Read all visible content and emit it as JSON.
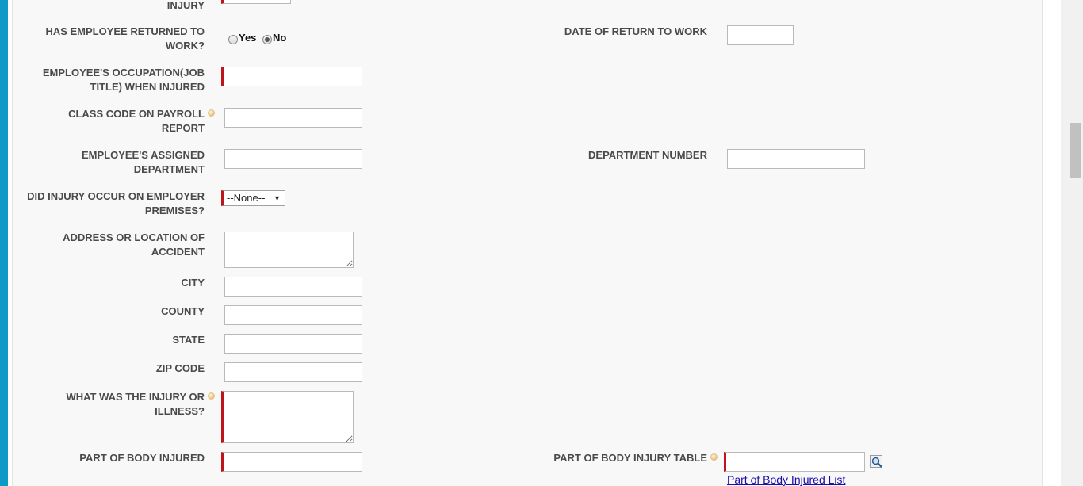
{
  "left_labels": {
    "injury_partial": "INJURY",
    "returned_to_work": "HAS EMPLOYEE RETURNED TO WORK?",
    "occupation": "EMPLOYEE'S OCCUPATION(JOB TITLE) WHEN INJURED",
    "class_code": "CLASS CODE ON PAYROLL REPORT",
    "assigned_department": "EMPLOYEE'S ASSIGNED DEPARTMENT",
    "on_premises": "DID INJURY OCCUR ON EMPLOYER PREMISES?",
    "address": "ADDRESS OR LOCATION OF ACCIDENT",
    "city": "CITY",
    "county": "COUNTY",
    "state": "STATE",
    "zip": "ZIP CODE",
    "injury_or_illness": "WHAT WAS THE INJURY OR ILLNESS?",
    "body_part": "PART OF BODY INJURED"
  },
  "right_labels": {
    "date_return": "DATE OF RETURN TO WORK",
    "department_number": "DEPARTMENT NUMBER",
    "body_injury_table": "PART OF BODY INJURY TABLE"
  },
  "returned_to_work": {
    "options": [
      "Yes",
      "No"
    ],
    "selected": "No"
  },
  "on_premises_select": {
    "value": "--None--"
  },
  "fields": {
    "occupation": "",
    "class_code": "",
    "assigned_department": "",
    "date_return": "",
    "department_number": "",
    "address": "",
    "city": "",
    "county": "",
    "state": "",
    "zip": "",
    "injury_or_illness": "",
    "body_part": "",
    "body_injury_table": ""
  },
  "links": {
    "body_injured_list": "Part of Body Injured List"
  },
  "icons": {
    "help": "info-bubble-icon",
    "lookup": "magnifier-lookup-icon"
  },
  "colors": {
    "required_marker": "#c0141c",
    "accent_border": "#0e9ac7",
    "link": "#1a0dab"
  }
}
